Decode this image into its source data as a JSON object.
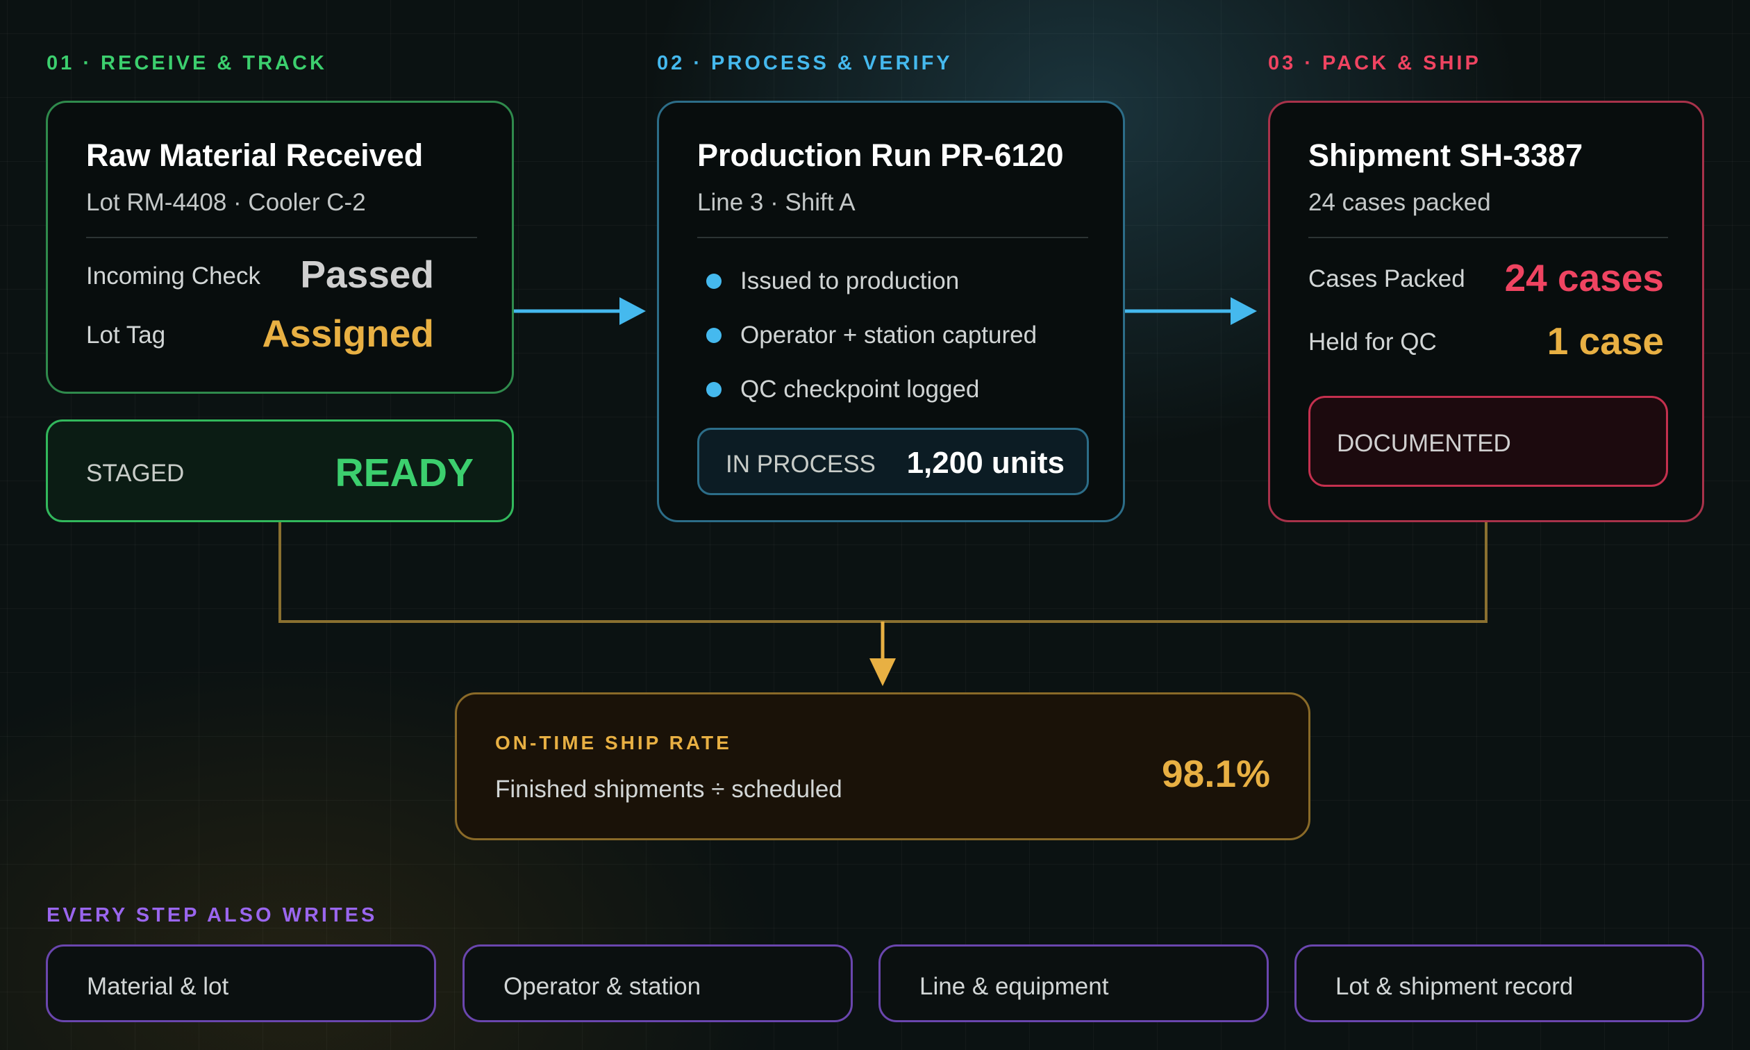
{
  "colors": {
    "green": "#3ccf6e",
    "blue": "#45b9ee",
    "red": "#ef4461",
    "amber": "#e8b043",
    "purple": "#9a66ee",
    "gray": "#cfcfcf"
  },
  "steps": [
    {
      "label": "01 · RECEIVE & TRACK",
      "title": "Raw Material Received",
      "subtitle": "Lot RM-4408 · Cooler C-2",
      "rows": [
        {
          "label": "Incoming Check",
          "value": "Passed"
        },
        {
          "label": "Lot Tag",
          "value": "Assigned"
        }
      ],
      "status": {
        "label": "STAGED",
        "value": "READY"
      }
    },
    {
      "label": "02 · PROCESS & VERIFY",
      "title": "Production Run PR-6120",
      "subtitle": "Line 3 · Shift A",
      "bullets": [
        "Issued to production",
        "Operator + station captured",
        "QC checkpoint logged"
      ],
      "status": {
        "label": "IN PROCESS",
        "value": "1,200 units"
      }
    },
    {
      "label": "03 · PACK & SHIP",
      "title": "Shipment SH-3387",
      "subtitle": "24 cases packed",
      "rows": [
        {
          "label": "Cases Packed",
          "value": "24 cases"
        },
        {
          "label": "Held for QC",
          "value": "1 case"
        }
      ],
      "status": {
        "label": "DOCUMENTED"
      }
    }
  ],
  "kpi": {
    "label": "ON-TIME SHIP RATE",
    "formula": "Finished shipments ÷ scheduled",
    "value": "98.1%"
  },
  "footer": {
    "label": "EVERY STEP ALSO WRITES",
    "items": [
      "Material & lot",
      "Operator & station",
      "Line & equipment",
      "Lot & shipment record"
    ]
  }
}
